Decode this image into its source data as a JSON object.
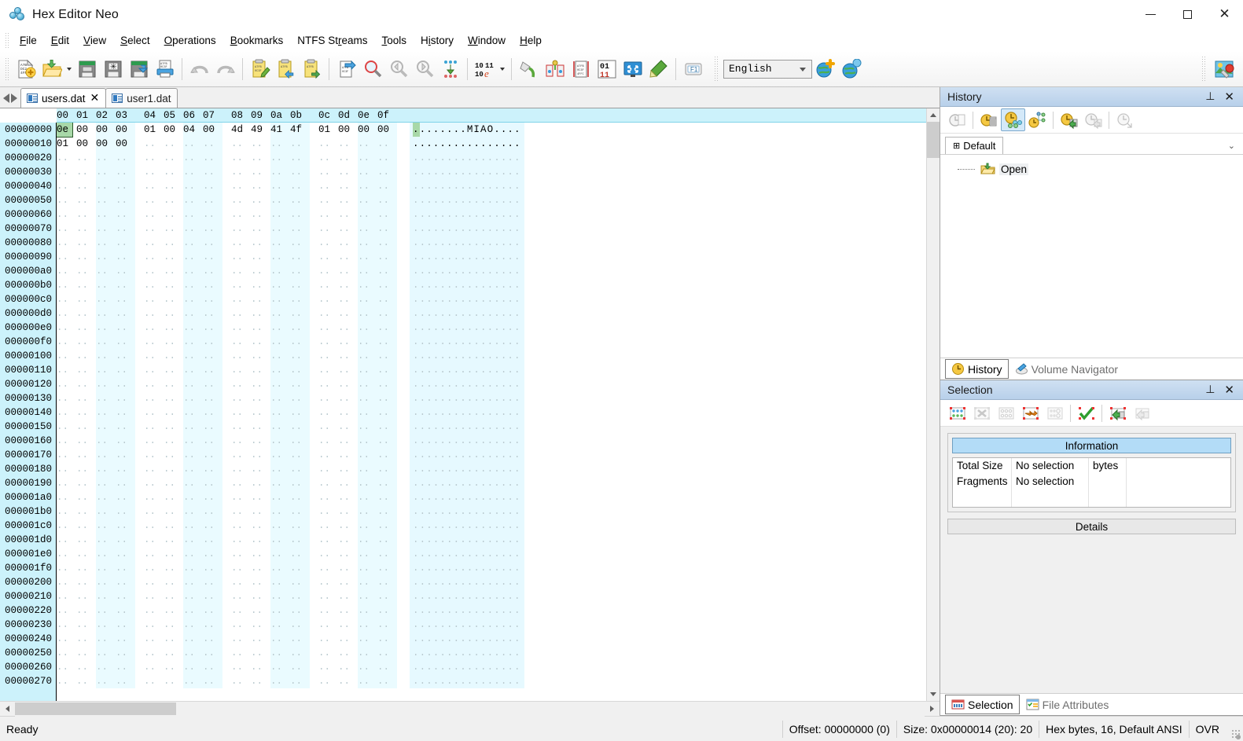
{
  "window": {
    "title": "Hex Editor Neo",
    "app_icon": "hex-editor-neo-logo",
    "minimize": "—",
    "maximize": "□",
    "close": "✕"
  },
  "menubar": {
    "items": [
      {
        "label": "File",
        "accel": "F"
      },
      {
        "label": "Edit",
        "accel": "E"
      },
      {
        "label": "View",
        "accel": "V"
      },
      {
        "label": "Select",
        "accel": "S"
      },
      {
        "label": "Operations",
        "accel": "O"
      },
      {
        "label": "Bookmarks",
        "accel": "B"
      },
      {
        "label": "NTFS Streams",
        "accel": "S"
      },
      {
        "label": "Tools",
        "accel": "T"
      },
      {
        "label": "History",
        "accel": "i"
      },
      {
        "label": "Window",
        "accel": "W"
      },
      {
        "label": "Help",
        "accel": "H"
      }
    ]
  },
  "toolbar": {
    "buttons": [
      {
        "name": "new-file-icon",
        "tip": "New"
      },
      {
        "name": "open-file-icon",
        "tip": "Open"
      },
      {
        "name": "open-dropdown-icon",
        "tip": "Open recent"
      },
      {
        "name": "save-icon",
        "tip": "Save"
      },
      {
        "name": "save-as-icon",
        "tip": "Save As"
      },
      {
        "name": "save-all-icon",
        "tip": "Save All"
      },
      {
        "name": "print-icon",
        "tip": "Print"
      },
      {
        "name": "undo-icon",
        "tip": "Undo"
      },
      {
        "name": "redo-icon",
        "tip": "Redo"
      },
      {
        "name": "edit-clipboard-icon",
        "tip": "Edit"
      },
      {
        "name": "cut-icon",
        "tip": "Cut"
      },
      {
        "name": "copy-icon",
        "tip": "Copy"
      },
      {
        "name": "paste-icon",
        "tip": "Paste"
      },
      {
        "name": "find-icon",
        "tip": "Find"
      },
      {
        "name": "find-prev-icon",
        "tip": "Find Previous"
      },
      {
        "name": "find-next-icon",
        "tip": "Find Next"
      },
      {
        "name": "replace-icon",
        "tip": "Replace"
      },
      {
        "name": "data-inspector-icon",
        "tip": "Data Inspector"
      },
      {
        "name": "fill-icon",
        "tip": "Fill"
      },
      {
        "name": "compare-icon",
        "tip": "Compare"
      },
      {
        "name": "pattern-icon",
        "tip": "Pattern"
      },
      {
        "name": "binary-icon",
        "tip": "Binary View"
      },
      {
        "name": "fullscreen-icon",
        "tip": "Full Screen"
      },
      {
        "name": "highlight-icon",
        "tip": "Highlight"
      },
      {
        "name": "help-f1-icon",
        "tip": "Help"
      }
    ],
    "language": {
      "label": "English",
      "options": [
        "English"
      ]
    },
    "globe_add_icon": "add-language-icon",
    "globe_info_icon": "language-info-icon",
    "settings_icon": "settings-image-icon"
  },
  "doc_tabs": {
    "nav_prev": "prev-tab-arrow",
    "nav_next": "next-tab-arrow",
    "tabs": [
      {
        "label": "users.dat",
        "active": true,
        "closable": true,
        "close_glyph": "✕"
      },
      {
        "label": "user1.dat",
        "active": false,
        "closable": false
      }
    ]
  },
  "hex_view": {
    "column_headers": [
      "00",
      "01",
      "02",
      "03",
      "04",
      "05",
      "06",
      "07",
      "08",
      "09",
      "0a",
      "0b",
      "0c",
      "0d",
      "0e",
      "0f"
    ],
    "offsets": [
      "00000000",
      "00000010",
      "00000020",
      "00000030",
      "00000040",
      "00000050",
      "00000060",
      "00000070",
      "00000080",
      "00000090",
      "000000a0",
      "000000b0",
      "000000c0",
      "000000d0",
      "000000e0",
      "000000f0",
      "00000100",
      "00000110",
      "00000120",
      "00000130",
      "00000140",
      "00000150",
      "00000160",
      "00000170",
      "00000180",
      "00000190",
      "000001a0",
      "000001b0",
      "000001c0",
      "000001d0",
      "000001e0",
      "000001f0",
      "00000200",
      "00000210",
      "00000220",
      "00000230",
      "00000240",
      "00000250",
      "00000260",
      "00000270"
    ],
    "rows": [
      {
        "offset": "00000000",
        "bytes": [
          "0e",
          "00",
          "00",
          "00",
          "01",
          "00",
          "04",
          "00",
          "4d",
          "49",
          "41",
          "4f",
          "01",
          "00",
          "00",
          "00"
        ],
        "defined": 16,
        "ascii": ".........MIAO....",
        "ascii_text": "........MIAO....",
        "selected_index": 0
      },
      {
        "offset": "00000010",
        "bytes": [
          "01",
          "00",
          "00",
          "00",
          "..",
          "..",
          "..",
          "..",
          "..",
          "..",
          "..",
          "..",
          "..",
          "..",
          "..",
          ".."
        ],
        "defined": 4,
        "ascii_text": "....",
        "selected_index": -1
      }
    ],
    "placeholder_byte": "..",
    "placeholder_ascii": ".",
    "row_count_visible": 40
  },
  "history_panel": {
    "title": "History",
    "pin_glyph": "⊥",
    "close_glyph": "✕",
    "toolbar_buttons": [
      {
        "name": "history-view-icon",
        "active": false,
        "disabled": true
      },
      {
        "name": "clear-history-icon",
        "active": false
      },
      {
        "name": "history-branch-icon",
        "active": true
      },
      {
        "name": "history-tree-icon",
        "active": false
      },
      {
        "name": "save-history-icon",
        "active": false
      },
      {
        "name": "load-history-icon",
        "active": false,
        "disabled": true
      },
      {
        "name": "history-settings-icon",
        "active": false,
        "disabled": true
      }
    ],
    "branch_tab": {
      "label": "Default",
      "pin_glyph": "⊞"
    },
    "chevron": "⌄",
    "tree": [
      {
        "label": "Open",
        "icon": "open-folder-icon"
      }
    ]
  },
  "dock_tabs_top": [
    {
      "label": "History",
      "icon": "clock-icon",
      "active": true
    },
    {
      "label": "Volume Navigator",
      "icon": "volume-navigator-icon",
      "active": false
    }
  ],
  "selection_panel": {
    "title": "Selection",
    "pin_glyph": "⊥",
    "close_glyph": "✕",
    "toolbar_buttons": [
      {
        "name": "select-all-icon",
        "active": false
      },
      {
        "name": "deselect-icon",
        "active": false,
        "disabled": true
      },
      {
        "name": "select-range-icon",
        "active": false,
        "disabled": true
      },
      {
        "name": "select-extend-icon",
        "active": false
      },
      {
        "name": "select-pattern-icon",
        "active": false,
        "disabled": true
      },
      {
        "name": "apply-selection-icon",
        "active": false
      },
      {
        "name": "selection-export-icon",
        "active": false
      },
      {
        "name": "selection-import-icon",
        "active": false,
        "disabled": true
      }
    ],
    "information_header": "Information",
    "table": {
      "rows": [
        {
          "label": "Total Size",
          "value": "No selection",
          "unit": "bytes"
        },
        {
          "label": "Fragments",
          "value": "No selection",
          "unit": ""
        }
      ]
    },
    "details_button": "Details"
  },
  "dock_tabs_bottom": [
    {
      "label": "Selection",
      "icon": "selection-icon",
      "active": true
    },
    {
      "label": "File Attributes",
      "icon": "file-attributes-icon",
      "active": false
    }
  ],
  "statusbar": {
    "ready": "Ready",
    "offset": "Offset: 00000000 (0)",
    "size": "Size: 0x00000014 (20): 20",
    "mode": "Hex bytes, 16, Default ANSI",
    "insert_mode": "OVR",
    "resize_grip": "resize-grip-icon"
  },
  "colors": {
    "offset_bg": "#ccf2fb",
    "header_bg": "#ccf2fb",
    "ascii_bg": "#e6f9ff",
    "column_stripe": "#eafbff",
    "selection_green": "#a8d8a8",
    "panel_caption": "#b8d0ea",
    "info_header": "#b3dcf7",
    "dim_text": "#b9c9cf"
  }
}
